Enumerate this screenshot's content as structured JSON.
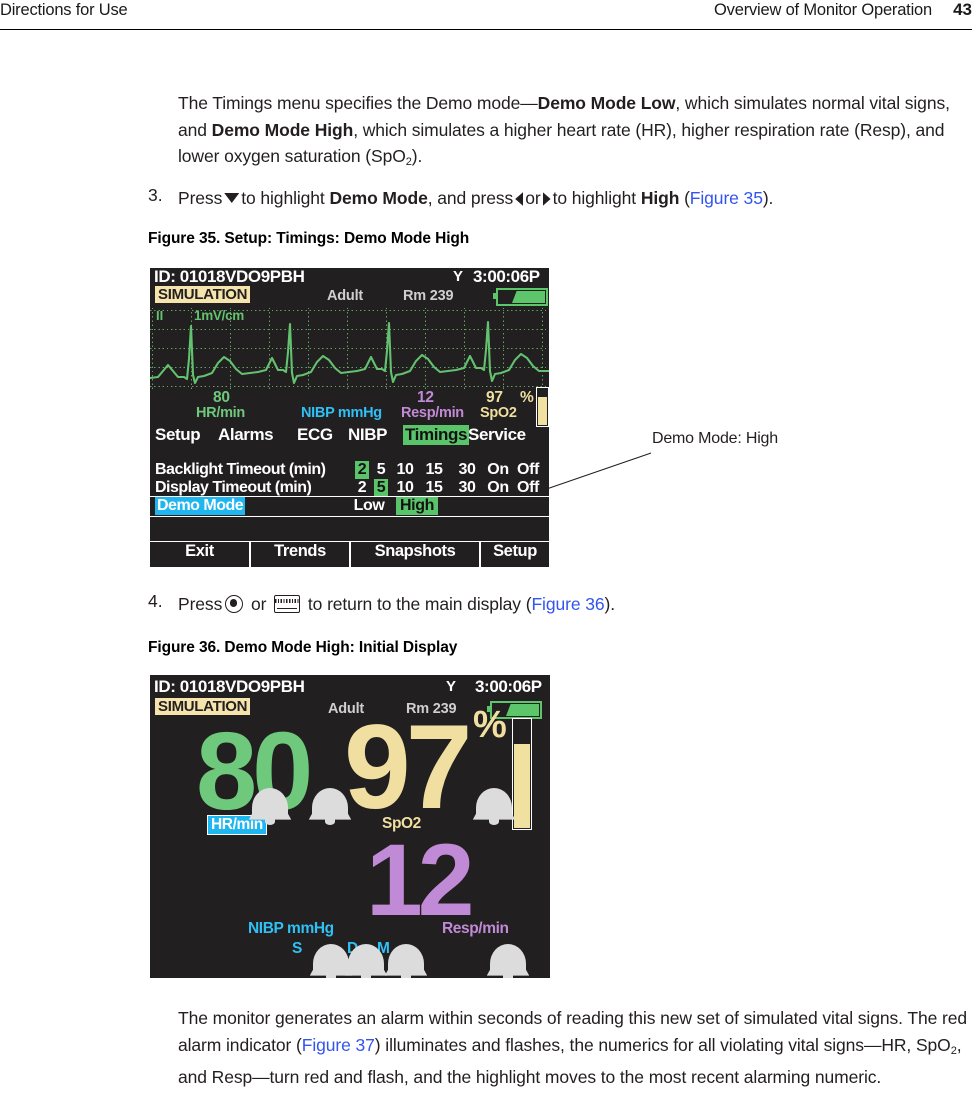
{
  "header": {
    "left": "Directions for Use",
    "right": "Overview of Monitor Operation",
    "page": "43"
  },
  "body": {
    "intro_p1": "The Timings menu specifies the Demo mode—",
    "intro_b1": "Demo Mode Low",
    "intro_p2": ", which simulates normal vital signs, and ",
    "intro_b2": "Demo Mode High",
    "intro_p3": ", which simulates a higher heart rate (HR), higher respiration rate (Resp), and lower oxygen saturation (SpO",
    "intro_sub": "2",
    "intro_p4": ").",
    "step3_num": "3.",
    "step3_a": "Press",
    "step3_b": "to highlight",
    "step3_bold1": "Demo Mode",
    "step3_c": ", and press",
    "step3_or": "or",
    "step3_d": "to highlight",
    "step3_bold2": "High",
    "step3_open": "(",
    "step3_xref": "Figure 35",
    "step3_close": ").",
    "step4_num": "4.",
    "step4_a": "Press",
    "step4_or": "or",
    "step4_b": "to return to the main display (",
    "step4_xref": "Figure 36",
    "step4_close": ").",
    "fig35_caption": "Figure 35.  Setup: Timings: Demo Mode High",
    "fig36_caption": "Figure 36.  Demo Mode High: Initial Display",
    "outro_1": "The monitor generates an alarm within seconds of reading this new set of simulated vital signs. The red alarm indicator (",
    "outro_xref": "Figure 37",
    "outro_2": ") illuminates and flashes, the numerics for all violating vital signs—HR, SpO",
    "outro_sub": "2",
    "outro_3": ", and Resp—turn red and flash, and the highlight moves to the most recent alarming numeric."
  },
  "callout": {
    "label": "Demo Mode: High"
  },
  "figure35": {
    "patient_id": "ID: 01018VDO9PBH",
    "antenna_icon": "antenna-icon",
    "time": "3:00:06P",
    "simulation_badge": "SIMULATION",
    "patient_type": "Adult",
    "room": "Rm 239",
    "battery_icon": "battery-icon",
    "ecg": {
      "lead": "II",
      "gain": "1mV/cm"
    },
    "numerics": {
      "hr_value": "80",
      "hr_label": "HR/min",
      "nibp_label": "NIBP mmHg",
      "resp_value": "12",
      "resp_label": "Resp/min",
      "spo2_value": "97",
      "spo2_pct": "%",
      "spo2_label": "SpO2"
    },
    "tabs": [
      {
        "label": "Setup",
        "selected": false
      },
      {
        "label": "Alarms",
        "selected": false
      },
      {
        "label": "ECG",
        "selected": false
      },
      {
        "label": "NIBP",
        "selected": false
      },
      {
        "label": "Timings",
        "selected": true
      },
      {
        "label": "Service",
        "selected": false
      }
    ],
    "settings": [
      {
        "label": "Backlight Timeout (min)",
        "active": false,
        "options": [
          "2",
          "5",
          "10",
          "15",
          "30",
          "On",
          "Off"
        ],
        "selected_index": 0
      },
      {
        "label": "Display Timeout (min)",
        "active": false,
        "options": [
          "2",
          "5",
          "10",
          "15",
          "30",
          "On",
          "Off"
        ],
        "selected_index": 1
      },
      {
        "label": "Demo Mode",
        "active": true,
        "options": [
          "Low",
          "High"
        ],
        "selected_index": 1
      }
    ],
    "softkeys": [
      "Exit",
      "Trends",
      "Snapshots",
      "Setup"
    ]
  },
  "figure36": {
    "patient_id": "ID: 01018VDO9PBH",
    "antenna_icon": "antenna-icon",
    "time": "3:00:06P",
    "simulation_badge": "SIMULATION",
    "patient_type": "Adult",
    "room": "Rm 239",
    "battery_icon": "battery-icon",
    "hr_value": "80",
    "hr_label": "HR/min",
    "spo2_value": "97",
    "spo2_pct": "%",
    "spo2_label": "SpO2",
    "resp_value": "12",
    "resp_label": "Resp/min",
    "nibp_label": "NIBP mmHg",
    "nibp_s": "S",
    "nibp_d": "D",
    "nibp_m": "M"
  },
  "colors": {
    "screen_bg": "#211f1f",
    "ecg_green": "#63c16f",
    "hr_green": "#6ec97c",
    "spo2_yellow": "#f0dfa0",
    "resp_purple": "#c18ad6",
    "nibp_cyan": "#2fc0f5",
    "select_green": "#5ac46a",
    "highlight_blue": "#1fb6f0",
    "sim_badge_bg": "#f5e4ab",
    "xref_blue": "#3355ee"
  }
}
